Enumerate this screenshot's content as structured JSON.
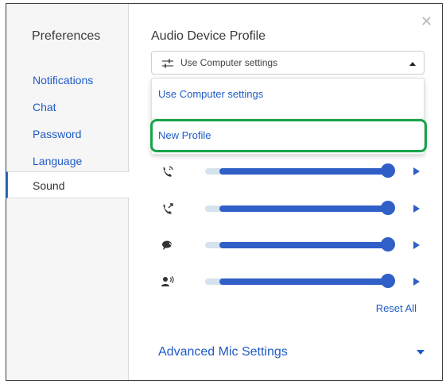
{
  "sidebar": {
    "title": "Preferences",
    "items": [
      {
        "label": "Notifications",
        "active": false
      },
      {
        "label": "Chat",
        "active": false
      },
      {
        "label": "Password",
        "active": false
      },
      {
        "label": "Language",
        "active": false
      },
      {
        "label": "Sound",
        "active": true
      }
    ]
  },
  "main": {
    "section_title": "Audio Device Profile",
    "profile_select": {
      "value": "Use Computer settings",
      "icon": "sliders-icon"
    },
    "dropdown": {
      "open": true,
      "options": [
        "Use Computer settings",
        "New Profile"
      ],
      "highlighted": "New Profile"
    },
    "sliders": [
      {
        "icon": "incoming-call-icon",
        "level": 1.0
      },
      {
        "icon": "outgoing-call-icon",
        "level": 1.0
      },
      {
        "icon": "chat-bubble-icon",
        "level": 1.0
      },
      {
        "icon": "speaking-person-icon",
        "level": 1.0
      }
    ],
    "reset_label": "Reset All",
    "advanced_label": "Advanced Mic Settings"
  },
  "colors": {
    "accent": "#2f5fc7",
    "link": "#1f5bc6",
    "highlight_border": "#18a349",
    "track": "#d5e3ee"
  }
}
